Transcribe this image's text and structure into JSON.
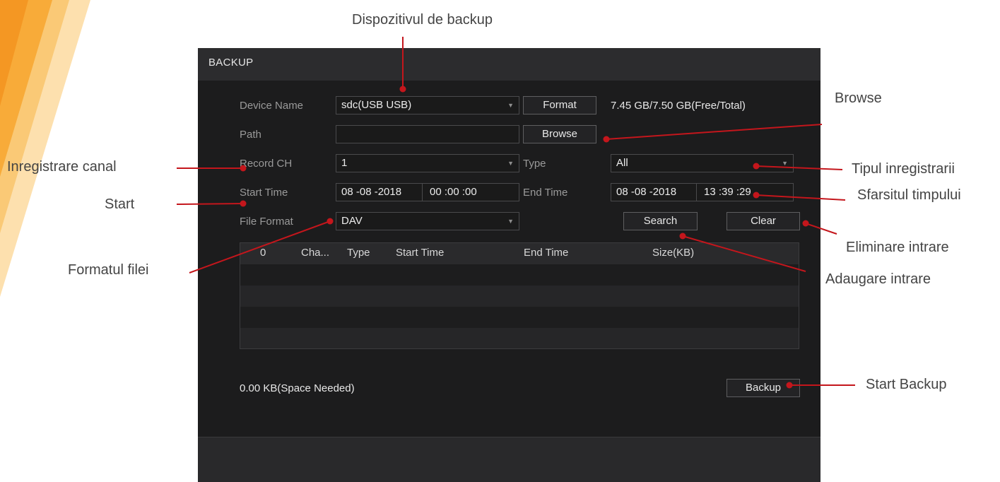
{
  "dialog": {
    "title": "BACKUP",
    "device_name": {
      "label": "Device Name",
      "value": "sdc(USB USB)"
    },
    "format_button": "Format",
    "capacity": "7.45 GB/7.50 GB(Free/Total)",
    "path": {
      "label": "Path",
      "value": ""
    },
    "browse_button": "Browse",
    "record_ch": {
      "label": "Record CH",
      "value": "1"
    },
    "type": {
      "label": "Type",
      "value": "All"
    },
    "start_time": {
      "label": "Start Time",
      "date": "08 -08 -2018",
      "time": "00 :00 :00"
    },
    "end_time": {
      "label": "End Time",
      "date": "08 -08 -2018",
      "time": "13 :39 :29"
    },
    "file_format": {
      "label": "File Format",
      "value": "DAV"
    },
    "search_button": "Search",
    "clear_button": "Clear",
    "table": {
      "columns": [
        "0",
        "Cha...",
        "Type",
        "Start Time",
        "End Time",
        "Size(KB)"
      ],
      "rows": []
    },
    "space_needed": "0.00 KB(Space Needed)",
    "backup_button": "Backup"
  },
  "annotations": {
    "backup_device": "Dispozitivul de backup",
    "browse": "Browse",
    "record_channel": "Inregistrare canal",
    "record_type": "Tipul inregistrarii",
    "start": "Start",
    "end_time": "Sfarsitul timpului",
    "clear_entry": "Eliminare intrare",
    "add_entry": "Adaugare intrare",
    "file_format": "Formatul filei",
    "start_backup": "Start Backup"
  },
  "colors": {
    "dialog_bg": "#1c1c1d",
    "annotation_line": "#c4161c",
    "decor_orange": "#f7a733"
  }
}
